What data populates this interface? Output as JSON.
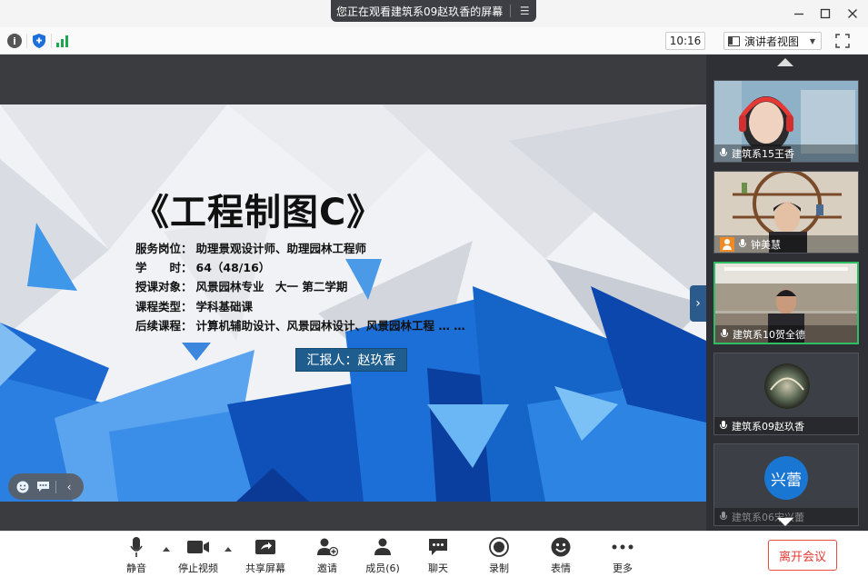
{
  "titlebar": {
    "sharing_text": "您正在观看建筑系09赵玖香的屏幕",
    "menu_icon": "list-icon",
    "minimize_icon": "minimize-icon",
    "maximize_icon": "maximize-icon",
    "close_icon": "close-icon"
  },
  "toolbar": {
    "info_icon": "i",
    "clock": "10:16",
    "view_mode": "演讲者视图"
  },
  "slide": {
    "title": "《工程制图C》",
    "lines": [
      {
        "label": "服务岗位：",
        "value": "助理景观设计师、助理园林工程师"
      },
      {
        "label": "学　　时：",
        "value": "64（48/16）"
      },
      {
        "label": "授课对象：",
        "value": "风景园林专业　大一 第二学期"
      },
      {
        "label": "课程类型：",
        "value": "学科基础课"
      },
      {
        "label": "后续课程：",
        "value": "计算机辅助设计、风景园林设计、风景园林工程 … …"
      }
    ],
    "reporter": "汇报人：赵玖香"
  },
  "participants": [
    {
      "name": "建筑系15王香",
      "kind": "video",
      "active": false
    },
    {
      "name": "钟美慧",
      "kind": "video",
      "host": true,
      "active": false
    },
    {
      "name": "建筑系10贺全德",
      "kind": "video",
      "active": true
    },
    {
      "name": "建筑系09赵玖香",
      "kind": "avatar-image",
      "active": false
    },
    {
      "name": "建筑系06宋兴蕾",
      "kind": "avatar-text",
      "avatar_text": "兴蕾",
      "active": false
    }
  ],
  "bottom": {
    "mute": "静音",
    "stop_video": "停止视频",
    "share_screen": "共享屏幕",
    "invite": "邀请",
    "members": "成员(6)",
    "chat": "聊天",
    "record": "录制",
    "emoji": "表情",
    "more": "更多",
    "leave": "离开会议"
  },
  "colors": {
    "accent_green": "#2fbf62",
    "leave_red": "#e53935",
    "avatar_blue": "#1976d2",
    "reporter_bg": "#1f5d8f"
  }
}
